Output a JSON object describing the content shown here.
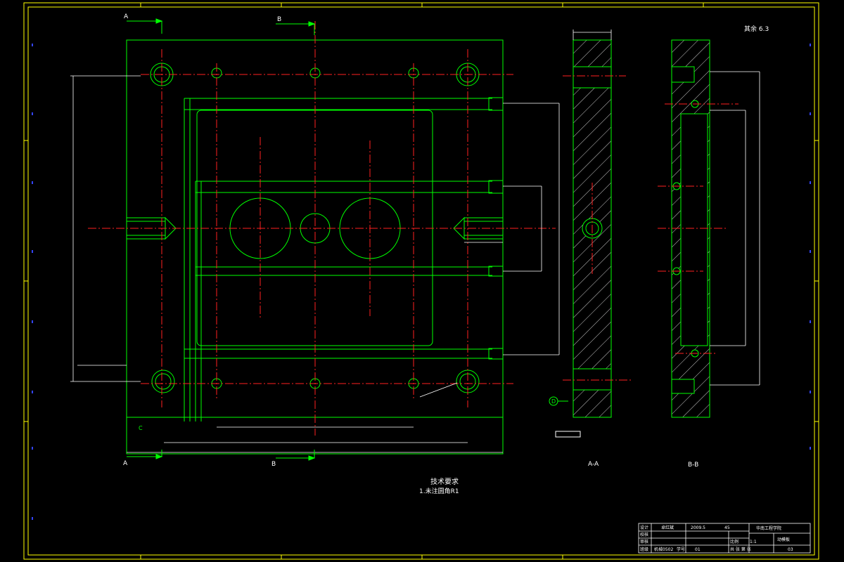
{
  "colors": {
    "background": "#000000",
    "border": "#ffff00",
    "outline": "#00ff00",
    "centerline": "#ff2020",
    "dimension": "#ffffff",
    "tick": "#3344ff",
    "hatch": "#ffffff"
  },
  "labels": {
    "section_a_top": "A",
    "section_b_top": "B",
    "section_a_bottom": "A",
    "section_b_bottom": "B",
    "view_aa": "A-A",
    "view_bb": "B-B",
    "datum_c": "C",
    "datum_d": "D",
    "roughness_note": "其余 6.3",
    "notes_title": "技术要求",
    "notes_item1": "1.未注圆角R1"
  },
  "title_block": {
    "r1c1": "设计",
    "r1c2": "卓红斌",
    "r1c3": "2009.5",
    "r1c4": "45",
    "r1c5": "华南工程学院",
    "r2c1": "校核",
    "r2c4": "比例",
    "r2c5": "1:1",
    "r2c6": "动模板",
    "r3c1": "审核",
    "r4c1": "班级",
    "r4c2": "机械0502",
    "r4c3": "学号",
    "r4c4": "01",
    "r4c5": "共 张 第 张",
    "r4c6": "03"
  }
}
